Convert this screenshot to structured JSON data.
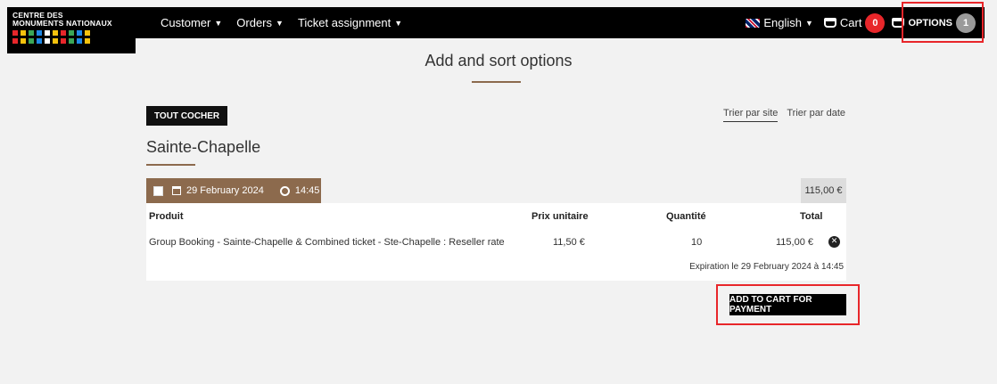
{
  "logo": {
    "line1": "CENTRE DES",
    "line2": "MONUMENTS NATIONAUX",
    "colors": [
      "#e8262a",
      "#f4c20d",
      "#3aa757",
      "#1e88e5",
      "#ffffff",
      "#f4c20d",
      "#e8262a",
      "#3aa757",
      "#1e88e5",
      "#f4c20d"
    ]
  },
  "nav": {
    "customer": "Customer",
    "orders": "Orders",
    "ticket": "Ticket assignment",
    "language": "English",
    "cart_label": "Cart",
    "cart_count": "0",
    "options_label": "OPTIONS",
    "options_count": "1"
  },
  "page": {
    "title": "Add and sort options",
    "tout_cocher": "TOUT COCHER",
    "sort_site": "Trier par site",
    "sort_date": "Trier par date",
    "site_name": "Sainte-Chapelle"
  },
  "group": {
    "date": "29 February 2024",
    "time": "14:45",
    "total": "115,00 €"
  },
  "table": {
    "headers": {
      "product": "Produit",
      "unit_price": "Prix unitaire",
      "quantity": "Quantité",
      "total": "Total"
    },
    "row": {
      "product": "Group Booking - Sainte-Chapelle & Combined ticket - Ste-Chapelle : Reseller rate",
      "unit_price": "11,50 €",
      "quantity": "10",
      "total": "115,00 €"
    },
    "expiration": "Expiration le 29 February 2024 à 14:45"
  },
  "actions": {
    "add_to_cart": "ADD TO CART FOR PAYMENT"
  },
  "colors": {
    "accent_brown": "#8c6a4d",
    "highlight_red": "#e8262a",
    "badge_red": "#e8262a",
    "badge_grey": "#9a9a9a"
  }
}
